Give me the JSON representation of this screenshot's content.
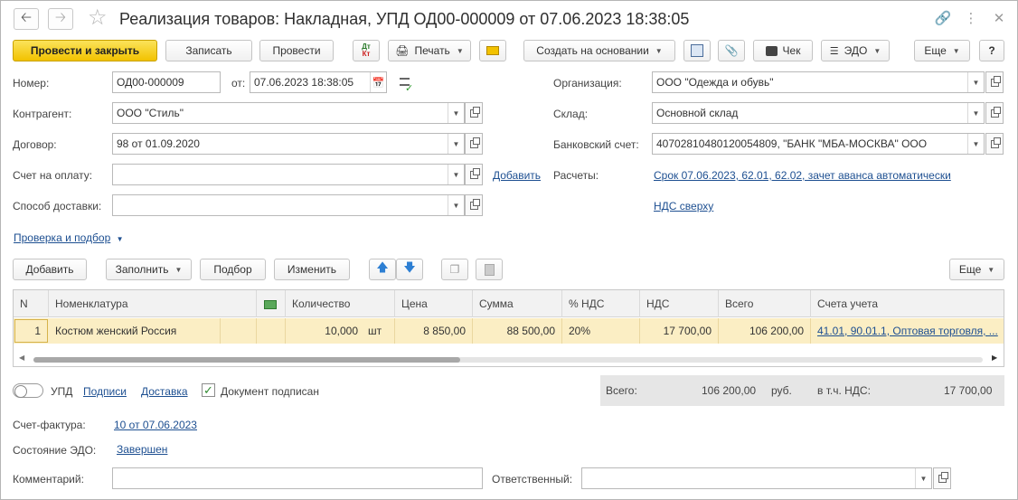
{
  "title": "Реализация товаров: Накладная, УПД ОД00-000009 от 07.06.2023 18:38:05",
  "icons": {
    "back": "arrow-left-icon",
    "forward": "arrow-right-icon",
    "favorite": "star-icon",
    "link": "link-icon",
    "more": "more-vertical-icon",
    "close": "close-icon"
  },
  "toolbar": {
    "post_close": "Провести и закрыть",
    "save": "Записать",
    "post": "Провести",
    "dtkt_dt": "Дт",
    "dtkt_kt": "Кт",
    "print": "Печать",
    "create_based": "Создать на основании",
    "receipt": "Чек",
    "edo": "ЭДО",
    "more": "Еще",
    "help": "?"
  },
  "form": {
    "number_label": "Номер:",
    "number": "ОД00-000009",
    "date_label": "от:",
    "date": "07.06.2023 18:38:05",
    "org_label": "Организация:",
    "org": "ООО \"Одежда и обувь\"",
    "counterparty_label": "Контрагент:",
    "counterparty": "ООО \"Стиль\"",
    "warehouse_label": "Склад:",
    "warehouse": "Основной склад",
    "contract_label": "Договор:",
    "contract": "98 от 01.09.2020",
    "bank_label": "Банковский счет:",
    "bank": "40702810480120054809, \"БАНК \"МБА-МОСКВА\" ООО",
    "invoice_label": "Счет на оплату:",
    "invoice": "",
    "add_link": "Добавить",
    "settlements_label": "Расчеты:",
    "settlements_link": "Срок 07.06.2023, 62.01, 62.02, зачет аванса автоматически",
    "delivery_label": "Способ доставки:",
    "delivery": "",
    "vat_link": "НДС сверху",
    "check_link": "Проверка и подбор"
  },
  "table_toolbar": {
    "add": "Добавить",
    "fill": "Заполнить",
    "pick": "Подбор",
    "edit": "Изменить",
    "more": "Еще"
  },
  "table": {
    "headers": {
      "n": "N",
      "item": "Номенклатура",
      "qty": "Количество",
      "price": "Цена",
      "sum": "Сумма",
      "vat_rate": "% НДС",
      "vat": "НДС",
      "total": "Всего",
      "accounts": "Счета учета"
    },
    "rows": [
      {
        "n": "1",
        "item": "Костюм женский Россия",
        "qty": "10,000",
        "unit": "шт",
        "price": "8 850,00",
        "sum": "88 500,00",
        "vat_rate": "20%",
        "vat": "17 700,00",
        "total": "106 200,00",
        "accounts": "41.01, 90.01.1, Оптовая торговля, ..."
      }
    ]
  },
  "footer": {
    "upd_label": "УПД",
    "signatures_link": "Подписи",
    "delivery_link": "Доставка",
    "signed_label": "Документ подписан",
    "signed_checked": true,
    "total_label": "Всего:",
    "total": "106 200,00",
    "currency": "руб.",
    "vat_label": "в т.ч. НДС:",
    "vat_total": "17 700,00",
    "invoice_label": "Счет-фактура:",
    "invoice_link": "10 от 07.06.2023",
    "edo_label": "Состояние ЭДО:",
    "edo_link": "Завершен",
    "comment_label": "Комментарий:",
    "comment": "",
    "responsible_label": "Ответственный:",
    "responsible": ""
  },
  "colors": {
    "primary_button": "#f5c800",
    "row_selected": "#fbeec4",
    "link": "#1d4f91",
    "totals_bg": "#e6e6e6"
  }
}
